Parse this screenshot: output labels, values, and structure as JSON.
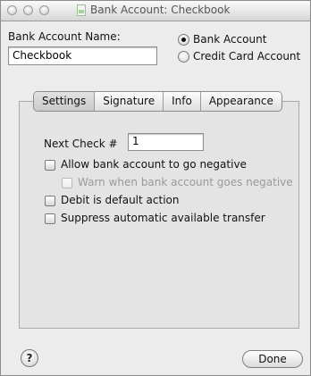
{
  "window": {
    "title": "Bank Account: Checkbook"
  },
  "account": {
    "name_label": "Bank Account Name:",
    "name_value": "Checkbook",
    "type_options": [
      {
        "label": "Bank Account",
        "selected": true
      },
      {
        "label": "Credit Card Account",
        "selected": false
      }
    ]
  },
  "tabs": [
    {
      "label": "Settings",
      "selected": true
    },
    {
      "label": "Signature",
      "selected": false
    },
    {
      "label": "Info",
      "selected": false
    },
    {
      "label": "Appearance",
      "selected": false
    }
  ],
  "settings": {
    "next_check_label": "Next Check #",
    "next_check_value": "1",
    "options": [
      {
        "label": "Allow bank account to go negative",
        "checked": false,
        "enabled": true
      },
      {
        "label": "Warn when bank account goes negative",
        "checked": false,
        "enabled": false
      },
      {
        "label": "Debit is default action",
        "checked": false,
        "enabled": true
      },
      {
        "label": "Suppress automatic available transfer",
        "checked": false,
        "enabled": true
      }
    ]
  },
  "footer": {
    "help_label": "?",
    "done_label": "Done"
  }
}
